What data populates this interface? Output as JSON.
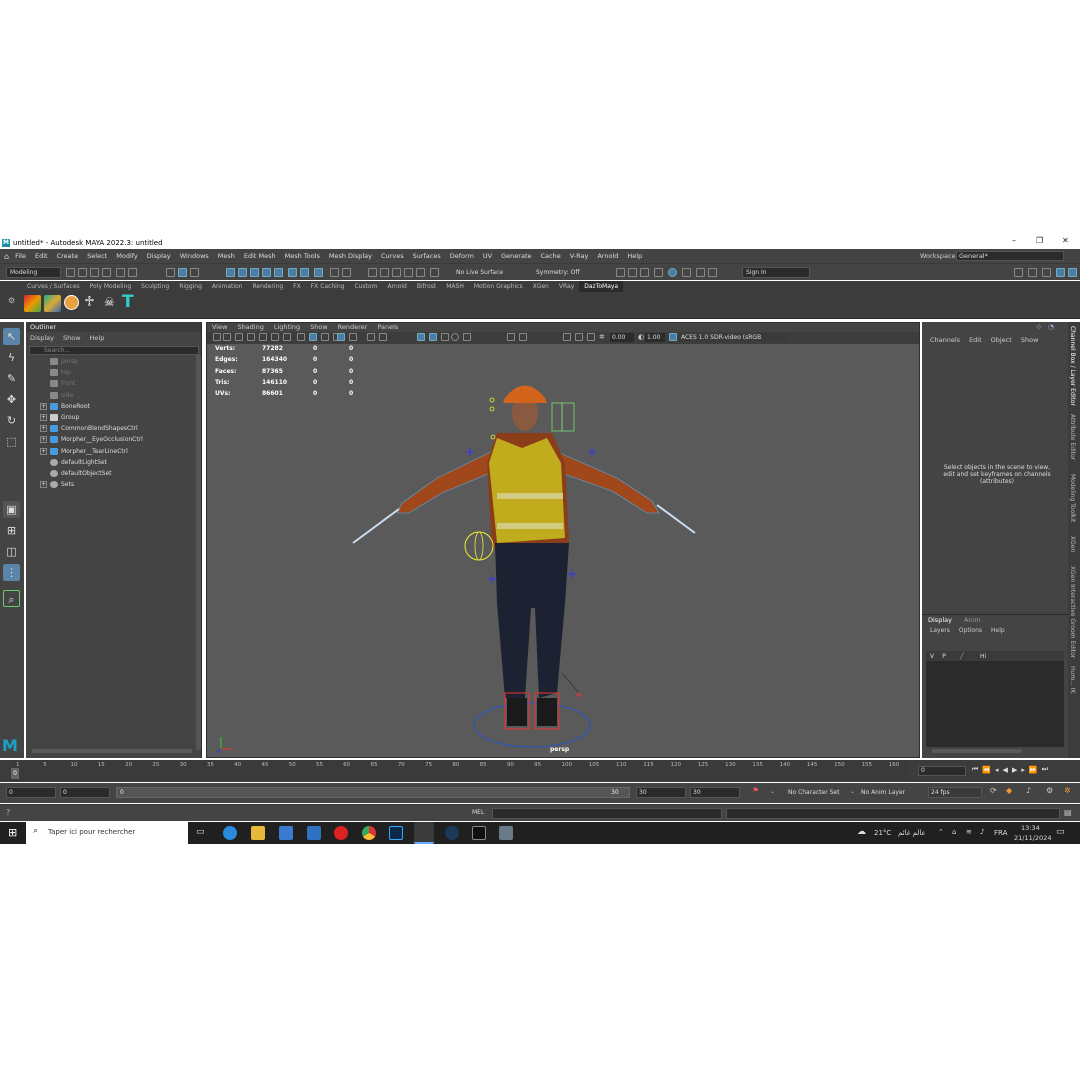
{
  "window": {
    "title": "untitled* - Autodesk MAYA 2022.3: untitled",
    "logo": "M",
    "controls": [
      "–",
      "❐",
      "✕"
    ]
  },
  "menubar": {
    "items": [
      "File",
      "Edit",
      "Create",
      "Select",
      "Modify",
      "Display",
      "Windows",
      "Mesh",
      "Edit Mesh",
      "Mesh Tools",
      "Mesh Display",
      "Curves",
      "Surfaces",
      "Deform",
      "UV",
      "Generate",
      "Cache",
      "V-Ray",
      "Arnold",
      "Help"
    ],
    "workspace_label": "Workspace:",
    "workspace_value": "General*"
  },
  "statusline": {
    "mode": "Modeling",
    "live_surface": "No Live Surface",
    "symmetry": "Symmetry: Off",
    "sign_in": "Sign In"
  },
  "shelf": {
    "tabs": [
      "Curves / Surfaces",
      "Poly Modeling",
      "Sculpting",
      "Rigging",
      "Animation",
      "Rendering",
      "FX",
      "FX Caching",
      "Custom",
      "Arnold",
      "Bifrost",
      "MASH",
      "Motion Graphics",
      "XGen",
      "VRay",
      "DazToMaya"
    ],
    "active_tab": "DazToMaya",
    "icons": [
      "daz-import-icon",
      "auto-ik-icon",
      "rig-icon",
      "t-pose-icon",
      "skull-icon",
      "joint-icon"
    ]
  },
  "outliner": {
    "title": "Outliner",
    "menu": [
      "Display",
      "Show",
      "Help"
    ],
    "search_placeholder": "Search...",
    "items": [
      {
        "label": "persp",
        "type": "camera",
        "dim": true,
        "expand": false
      },
      {
        "label": "top",
        "type": "camera",
        "dim": true,
        "expand": false
      },
      {
        "label": "front",
        "type": "camera",
        "dim": true,
        "expand": false
      },
      {
        "label": "side",
        "type": "camera",
        "dim": true,
        "expand": false
      },
      {
        "label": "BoneRoot",
        "type": "joint",
        "dim": false,
        "expand": true
      },
      {
        "label": "Group",
        "type": "group",
        "dim": false,
        "expand": true
      },
      {
        "label": "CommonBlendShapesCtrl",
        "type": "curve",
        "dim": false,
        "expand": true
      },
      {
        "label": "Morpher__EyeOcclusionCtrl",
        "type": "curve",
        "dim": false,
        "expand": true
      },
      {
        "label": "Morpher__TearLineCtrl",
        "type": "curve",
        "dim": false,
        "expand": true
      },
      {
        "label": "defaultLightSet",
        "type": "set",
        "dim": false,
        "expand": false
      },
      {
        "label": "defaultObjectSet",
        "type": "set",
        "dim": false,
        "expand": false
      },
      {
        "label": "Sets",
        "type": "set",
        "dim": false,
        "expand": true
      }
    ]
  },
  "viewport": {
    "menu": [
      "View",
      "Shading",
      "Lighting",
      "Show",
      "Renderer",
      "Panels"
    ],
    "exposure": "0.00",
    "gamma": "1.00",
    "color_space": "ACES 1.0 SDR-video (sRGB",
    "camera_label": "persp",
    "stats": [
      {
        "label": "Verts:",
        "v1": "77282",
        "v2": "0",
        "v3": "0"
      },
      {
        "label": "Edges:",
        "v1": "164340",
        "v2": "0",
        "v3": "0"
      },
      {
        "label": "Faces:",
        "v1": "87365",
        "v2": "0",
        "v3": "0"
      },
      {
        "label": "Tris:",
        "v1": "146110",
        "v2": "0",
        "v3": "0"
      },
      {
        "label": "UVs:",
        "v1": "86601",
        "v2": "0",
        "v3": "0"
      }
    ]
  },
  "channelbox": {
    "menu": [
      "Channels",
      "Edit",
      "Object",
      "Show"
    ],
    "hint": "Select objects in the scene to view, edit and set keyframes on channels (attributes)"
  },
  "layereditor": {
    "tabs": [
      "Display",
      "Anim"
    ],
    "menu": [
      "Layers",
      "Options",
      "Help"
    ],
    "layer": {
      "v": "V",
      "p": "P",
      "name": "Hi"
    }
  },
  "sidetabs": [
    "Channel Box / Layer Editor",
    "Attribute Editor",
    "Modeling Toolkit",
    "XGen",
    "XGen Interactive Groom Editor",
    "Hum... IK"
  ],
  "timeline": {
    "ticks": [
      "1",
      "5",
      "10",
      "15",
      "20",
      "25",
      "30",
      "35",
      "40",
      "45",
      "50",
      "55",
      "60",
      "65",
      "70",
      "75",
      "80",
      "85",
      "90",
      "95",
      "100",
      "105",
      "110",
      "115",
      "120",
      "125",
      "130",
      "135",
      "140",
      "145",
      "150",
      "155",
      "160"
    ],
    "current_frame": "0",
    "frame_field": "0"
  },
  "range": {
    "start": "0",
    "start2": "0",
    "slider_start": "0",
    "slider_end": "30",
    "end": "30",
    "end2": "30",
    "character_set": "No Character Set",
    "anim_layer": "No Anim Layer",
    "fps": "24 fps"
  },
  "cmdline": {
    "label": "MEL"
  },
  "taskbar": {
    "search_placeholder": "Taper ici pour rechercher",
    "weather": "21°C",
    "weather_text": "عالم غائم",
    "lang": "FRA",
    "time": "13:34",
    "date": "21/11/2024"
  }
}
